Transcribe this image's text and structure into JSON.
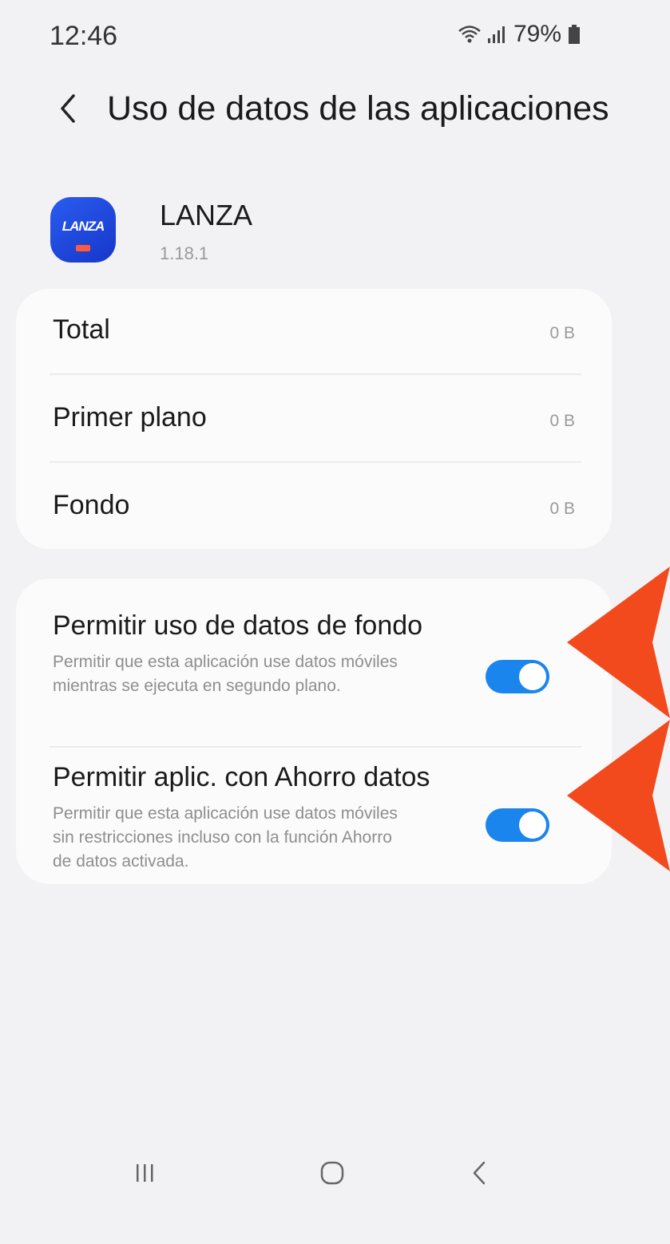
{
  "status_bar": {
    "time": "12:46",
    "battery": "79%",
    "icons": [
      "wifi-icon",
      "signal-icon",
      "battery-icon"
    ]
  },
  "header": {
    "back_icon": "chevron-left-icon",
    "title": "Uso de datos de las aplicaciones"
  },
  "app": {
    "icon_text": "LANZA",
    "name": "LANZA",
    "version": "1.18.1"
  },
  "usage": {
    "rows": [
      {
        "label": "Total",
        "value": "0 B"
      },
      {
        "label": "Primer plano",
        "value": "0 B"
      },
      {
        "label": "Fondo",
        "value": "0 B"
      }
    ]
  },
  "settings": {
    "toggles": [
      {
        "title": "Permitir uso de datos de fondo",
        "description": "Permitir que esta aplicación use datos móviles mientras se ejecuta en segundo plano.",
        "enabled": true
      },
      {
        "title": "Permitir aplic. con Ahorro datos",
        "description": "Permitir que esta aplicación use datos móviles sin restricciones incluso con la función Ahorro de datos activada.",
        "enabled": true
      }
    ]
  },
  "annotations": {
    "arrow_color": "#f24a1c",
    "arrow_icon": "arrow-pointer-icon"
  },
  "nav_bar": {
    "items": [
      "recent-apps-icon",
      "home-icon",
      "back-icon"
    ]
  },
  "colors": {
    "accent": "#1a85ec",
    "background": "#f2f2f4",
    "card": "#fbfbfb"
  }
}
